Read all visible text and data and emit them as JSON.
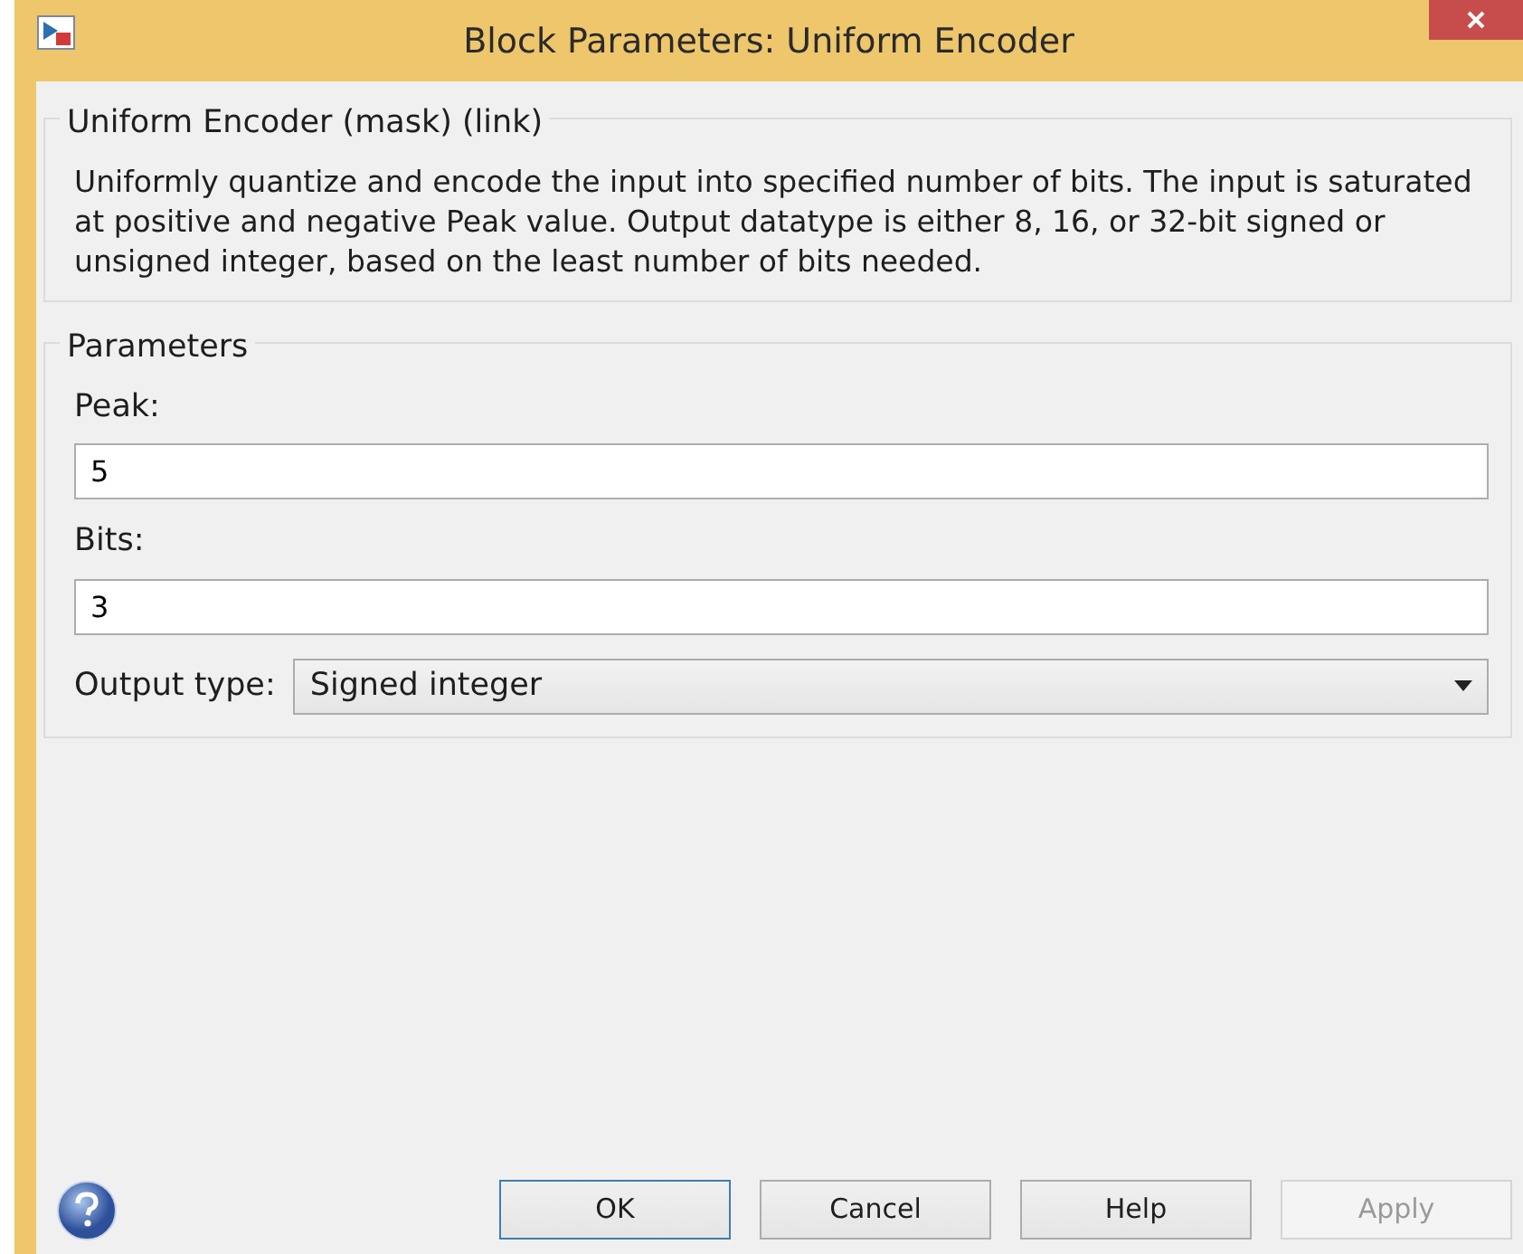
{
  "window": {
    "title": "Block Parameters: Uniform Encoder"
  },
  "description_group": {
    "title": "Uniform Encoder (mask) (link)",
    "text": "Uniformly quantize and encode the input into specified number of bits. The input is saturated at positive and negative Peak value. Output datatype is either 8, 16, or 32-bit signed or unsigned integer, based on the least number of bits needed."
  },
  "parameters_group": {
    "title": "Parameters",
    "fields": [
      {
        "kind": "text",
        "label": "Peak:",
        "value": "5"
      },
      {
        "kind": "text",
        "label": "Bits:",
        "value": "3"
      },
      {
        "kind": "dropdown",
        "label": "Output type:",
        "value": "Signed integer"
      }
    ]
  },
  "buttons": [
    {
      "label": "OK",
      "default": true,
      "disabled": false
    },
    {
      "label": "Cancel",
      "default": false,
      "disabled": false
    },
    {
      "label": "Help",
      "default": false,
      "disabled": false
    },
    {
      "label": "Apply",
      "default": false,
      "disabled": true
    }
  ]
}
